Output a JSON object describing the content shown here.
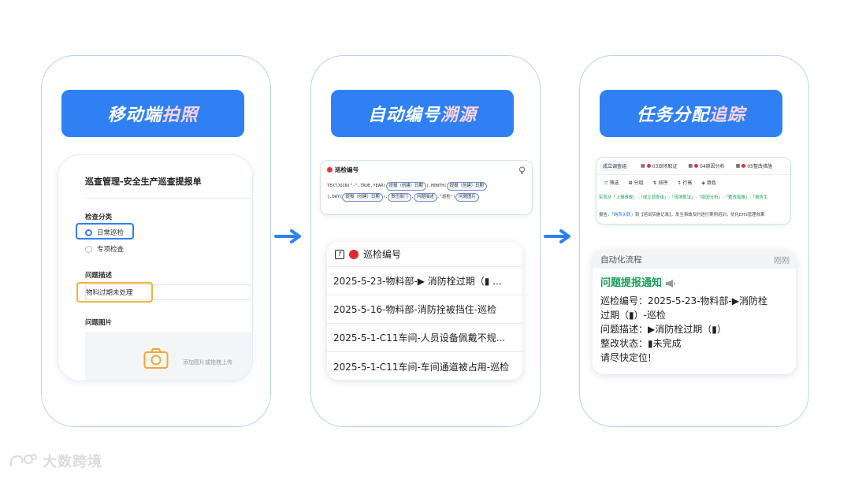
{
  "panel1": {
    "title_main": "移动端",
    "title_hl": "拍照",
    "form_title": "巡查管理-安全生产巡查提报单",
    "check_type_label": "检查分类",
    "option_daily": "日常巡检",
    "option_special": "专项检查",
    "problem_desc_label": "问题描述",
    "problem_desc_value": "物料过期未处理",
    "problem_image_label": "问题图片",
    "upload_hint": "添加图片或拖拽上传"
  },
  "panel2": {
    "title_main": "自动编号",
    "title_hl": "溯源",
    "formula_field": "巡检编号",
    "formula": {
      "p1": "TEXTJOIN(\"-\",TRUE,YEAR(",
      "chip1": "提报（创建）日期",
      "p2": "),MONTH(",
      "chip2": "提报（创建）日期",
      "p3": "),DAY(",
      "chip3": "提报（创建）日期",
      "p4": "),",
      "chip4": "责任部门",
      "p5": ",",
      "chip5": "问题描述",
      "p6": ",\"巡检\")",
      "chip6": "问题图片"
    },
    "list_header": "巡检编号",
    "rows": [
      "2025-5-23-物料部-▶ 消防栓过期（▮ ...",
      "2025-5-16-物料部-消防拴被挡住-巡检",
      "2025-5-1-C11车间-人员设备佩戴不规...",
      "2025-5-1-C11车间-车间通道被占用-巡检"
    ]
  },
  "panel3": {
    "title_main": "任务分配",
    "title_hl": "追踪",
    "tabs": [
      "成立调查组",
      "03现场取证",
      "04原因分析",
      "05整改措施"
    ],
    "tools": [
      "筛选",
      "分组",
      "排序",
      "行高",
      "填色"
    ],
    "sheet_line1": "实现从「上报事故」-「成立调查组」-「现场取证」-「原因分析」-「整改措施」-「报告生",
    "sheet_line2_a": "报告，",
    "sheet_line2_b": "「跨表关联」",
    "sheet_line2_c": "到【培训实施记录】，发生事故及时进行案例培训，优化EHS管理效果",
    "notify_source": "自动化流程",
    "notify_time": "刚刚",
    "notify_title": "问题提报通知",
    "line1": "巡检编号：2025-5-23-物料部-▶消防栓",
    "line2": "过期（▮）-巡检",
    "line3": "问题描述：▶消防栓过期（▮）",
    "line4": "整改状态：▮未完成",
    "line5": "请尽快定位!"
  },
  "brand": "大数跨境",
  "colors": {
    "accent": "#2f80f3",
    "highlight": "#f2b43a",
    "green": "#18a058"
  }
}
